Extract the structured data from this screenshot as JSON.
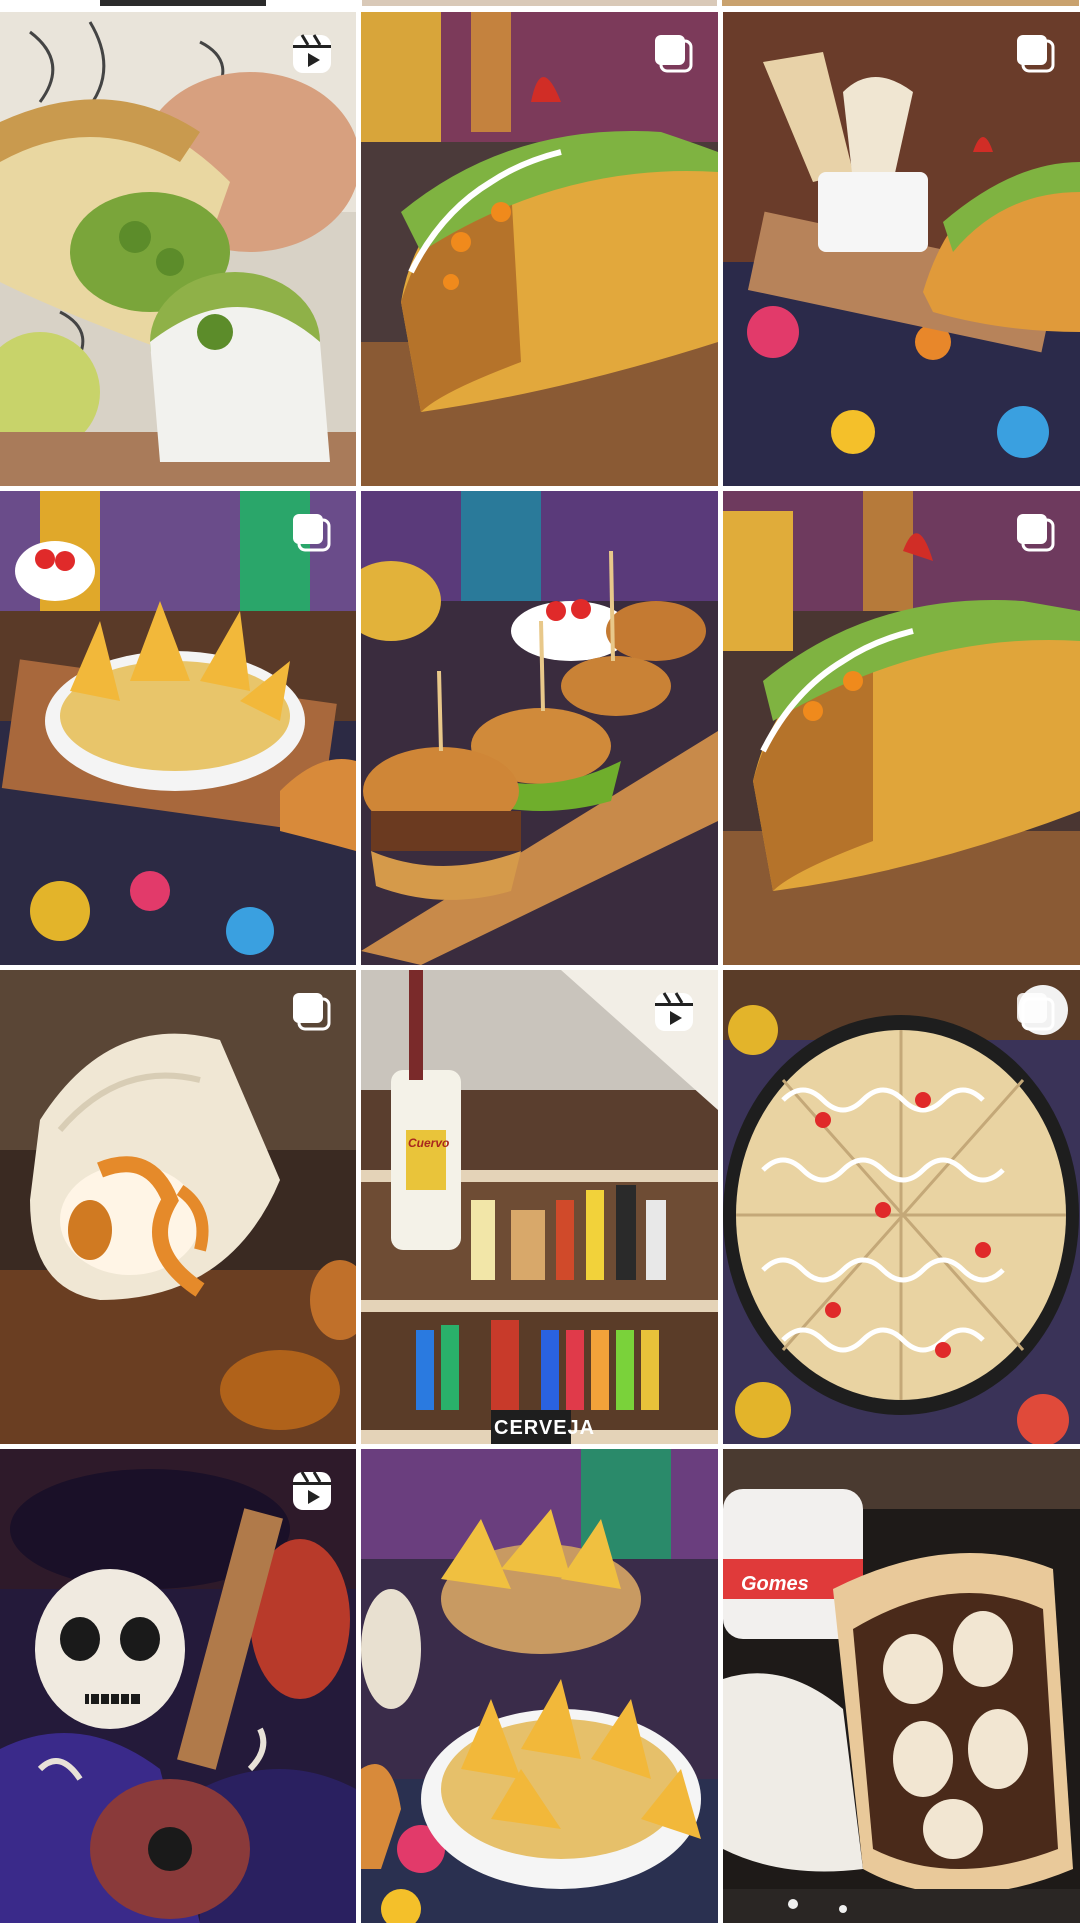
{
  "grid": {
    "tiles": [
      {
        "type": "reel",
        "content": "burrito-broccoli"
      },
      {
        "type": "carousel",
        "content": "taco"
      },
      {
        "type": "carousel",
        "content": "tacos-and-cones"
      },
      {
        "type": "carousel",
        "content": "nachos-cheese"
      },
      {
        "type": "carousel",
        "content": "sliders"
      },
      {
        "type": "carousel",
        "content": "taco-closeup"
      },
      {
        "type": "carousel",
        "content": "wrap-sauce"
      },
      {
        "type": "reel",
        "content": "bar-shelf"
      },
      {
        "type": "carousel",
        "content": "quesadilla"
      },
      {
        "type": "reel",
        "content": "skeleton-guitar"
      },
      {
        "type": "carousel",
        "content": "nachos-bowl"
      },
      {
        "type": "none",
        "content": "chocolate-wrap"
      }
    ]
  },
  "bar_sign": {
    "text": "CERVEJA"
  },
  "bottle_label": {
    "text": "Cuervo"
  },
  "jar_label": {
    "text": "Gomes"
  }
}
